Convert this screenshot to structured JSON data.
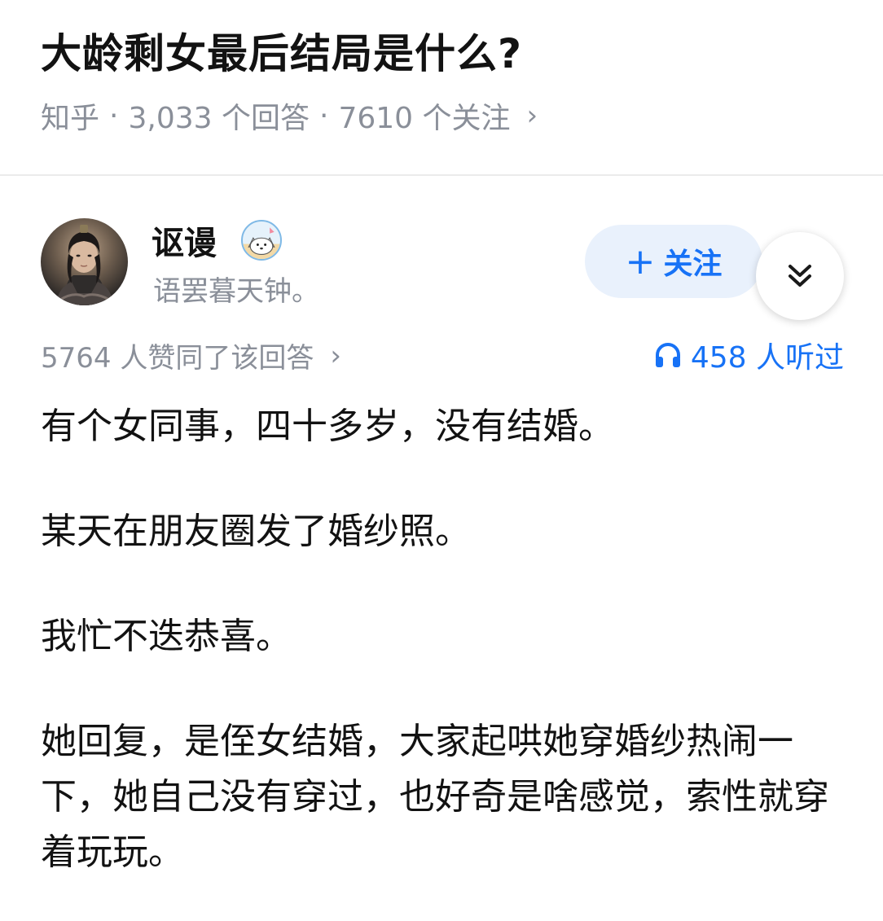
{
  "question": {
    "title": "大龄剩女最后结局是什么?",
    "source": "知乎",
    "separator": "·",
    "answer_count": "3,033 个回答",
    "follower_count": "7610 个关注",
    "chevron": "›"
  },
  "author": {
    "name": "讴谩",
    "signature": "语罢暮天钟。",
    "badge_icon": "cartoon-badge-icon",
    "avatar_icon": "warrior-avatar"
  },
  "follow_button": {
    "plus": "+",
    "label": "关注"
  },
  "collapse_icon": "double-chevron-down-icon",
  "stats": {
    "upvotes": "5764 人赞同了该回答",
    "chevron": "›",
    "listen_icon": "headphones-icon",
    "listeners": "458 人听过"
  },
  "content": {
    "paragraphs": [
      "有个女同事，四十多岁，没有结婚。",
      "某天在朋友圈发了婚纱照。",
      "我忙不迭恭喜。",
      "她回复，是侄女结婚，大家起哄她穿婚纱热闹一下，她自己没有穿过，也好奇是啥感觉，索性就穿着玩玩。"
    ]
  },
  "colors": {
    "accent": "#1772f6",
    "follow_bg": "#e9f1fc",
    "muted_text": "#8a8f99",
    "main_text": "#121212"
  }
}
